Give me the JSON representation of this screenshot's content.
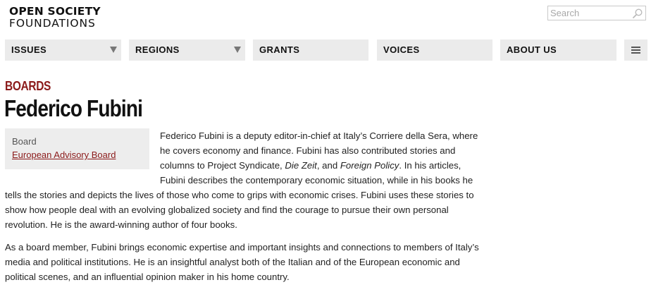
{
  "logo": {
    "line1": "OPEN SOCIETY",
    "line2": "FOUNDATIONS"
  },
  "search": {
    "placeholder": "Search",
    "icon": "magnifier-icon"
  },
  "nav": {
    "items": [
      {
        "label": "ISSUES",
        "dropdown": true
      },
      {
        "label": "REGIONS",
        "dropdown": true
      },
      {
        "label": "GRANTS",
        "dropdown": false
      },
      {
        "label": "VOICES",
        "dropdown": false
      },
      {
        "label": "ABOUT US",
        "dropdown": false
      }
    ],
    "menu_icon": "hamburger-icon"
  },
  "section_label": "BOARDS",
  "page_title": "Federico Fubini",
  "info_box": {
    "label": "Board",
    "link": "European Advisory Board"
  },
  "bio": {
    "p1_a": "Federico Fubini is a deputy editor-in-chief at Italy’s Corriere della Sera, where he covers economy and finance. Fubini has also contributed stories and columns to Project Syndicate, ",
    "p1_em1": "Die Zeit",
    "p1_b": ", and ",
    "p1_em2": "Foreign Policy",
    "p1_c": ". In his articles, Fubini describes the contemporary economic situation, while in his books he tells the stories and depicts the lives of those who come to grips with economic crises. Fubini uses these stories to show how people deal with an evolving globalized society and find the courage to pursue their own personal revolution. He is the award-winning author of four books.",
    "p2": "As a board member, Fubini brings economic expertise and important insights and connections to members of Italy’s media and political institutions. He is an insightful analyst both of the Italian and of the European economic and political scenes, and an influential opinion maker in his home country."
  },
  "colors": {
    "accent": "#8b1a1a",
    "nav_bg": "#ebebeb",
    "box_bg": "#ededed"
  }
}
